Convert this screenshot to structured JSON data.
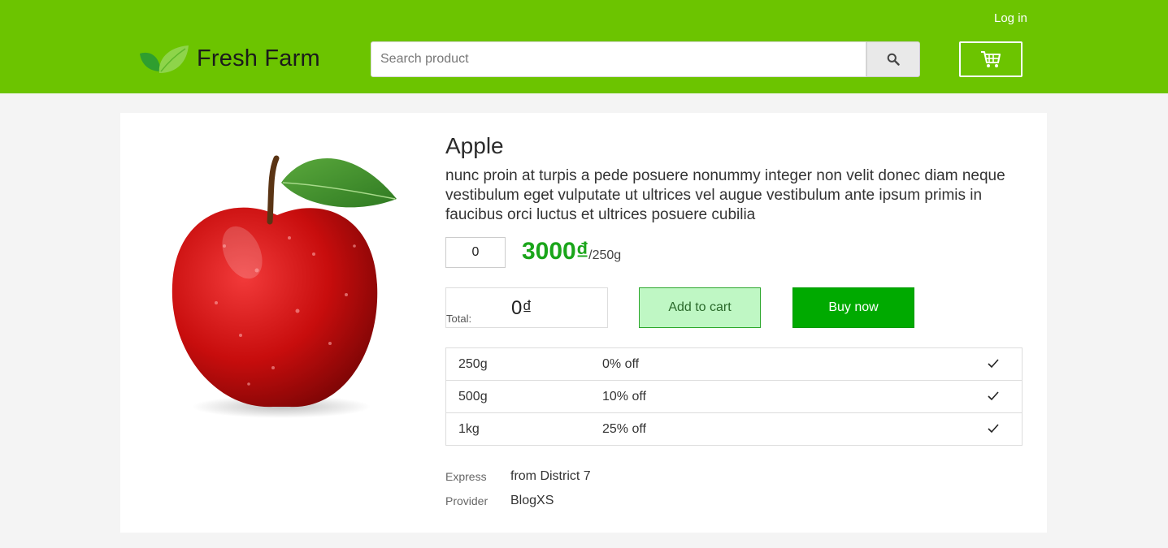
{
  "header": {
    "login_label": "Log in",
    "logo_text": "Fresh Farm",
    "search_placeholder": "Search product",
    "search_icon": "search-icon",
    "cart_icon": "cart-icon"
  },
  "product": {
    "title": "Apple",
    "description": "nunc proin at turpis a pede posuere nonummy integer non velit donec diam neque vestibulum eget vulputate ut ultrices vel augue vestibulum ante ipsum primis in faucibus orci luctus et ultrices posuere cubilia",
    "quantity": "0",
    "price": "3000₫",
    "price_unit": "/250g",
    "total_label": "Total:",
    "total_value": "0₫",
    "add_to_cart_label": "Add to cart",
    "buy_now_label": "Buy now",
    "options": [
      {
        "weight": "250g",
        "discount": "0% off",
        "selected_icon": "check-icon"
      },
      {
        "weight": "500g",
        "discount": "10% off",
        "selected_icon": "check-icon"
      },
      {
        "weight": "1kg",
        "discount": "25% off",
        "selected_icon": "check-icon"
      }
    ],
    "express_label": "Express",
    "express_value": "from District 7",
    "provider_label": "Provider",
    "provider_value": "BlogXS"
  },
  "colors": {
    "header_green": "#6cc400",
    "price_green": "#1aa51a",
    "buy_button_green": "#00aa00",
    "add_button_bg": "#bff7c4"
  }
}
